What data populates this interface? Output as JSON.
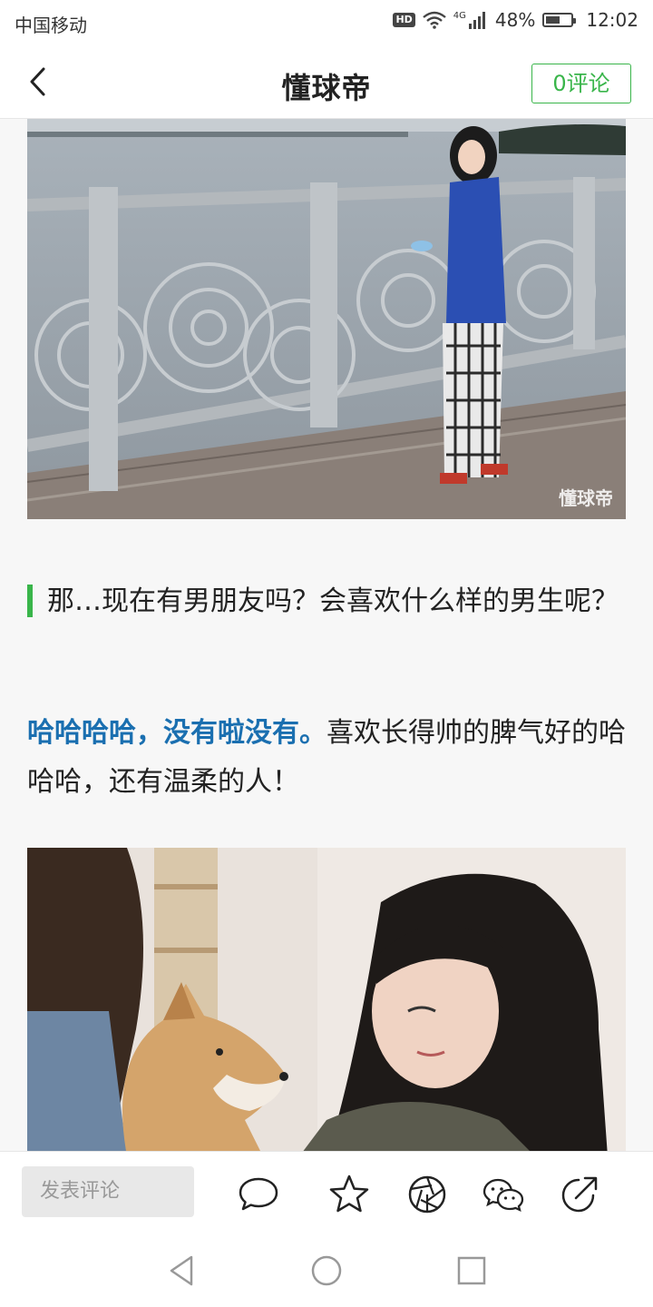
{
  "status_bar": {
    "carrier": "中国移动",
    "network": "4G",
    "battery": "48%",
    "time": "12:02",
    "battery_level": 0.48
  },
  "header": {
    "logo": "懂球帝",
    "comment_button": "0评论"
  },
  "article": {
    "photo1_watermark": "懂球帝",
    "question": "那…现在有男朋友吗？会喜欢什么样的男生呢？",
    "answer_highlight": "哈哈哈哈，没有啦没有。",
    "answer_rest": "喜欢长得帅的脾气好的哈哈哈，还有温柔的人！"
  },
  "action_bar": {
    "comment_placeholder": "发表评论",
    "icons": [
      "comment-bubble-icon",
      "star-icon",
      "moments-aperture-icon",
      "wechat-icon",
      "share-icon"
    ]
  },
  "colors": {
    "accent_green": "#39b54a",
    "highlight_blue": "#1a6fb0"
  }
}
